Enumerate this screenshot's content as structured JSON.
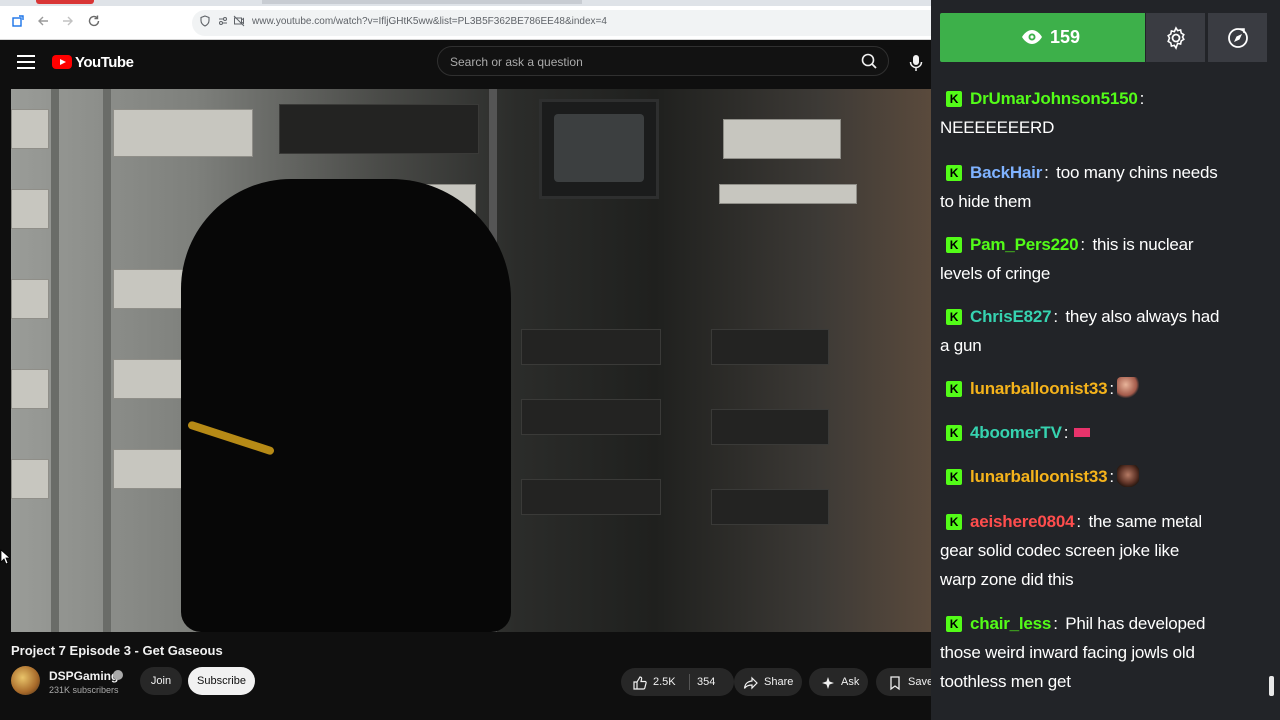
{
  "browser": {
    "url": "www.youtube.com/watch?v=IfljGHtK5ww&list=PL3B5F362BE786EE48&index=4"
  },
  "youtube": {
    "logo_text": "YouTube",
    "search_placeholder": "Search or ask a question"
  },
  "video": {
    "title": "Project 7 Episode 3 - Get Gaseous",
    "channel": "DSPGaming",
    "subscribers": "231K subscribers",
    "join_label": "Join",
    "subscribe_label": "Subscribe",
    "likes": "2.5K",
    "comments": "354",
    "share_label": "Share",
    "ask_label": "Ask",
    "save_label": "Save"
  },
  "chat": {
    "viewer_count": "159",
    "colors": {
      "viewer_bar": "#3db04a",
      "kick_badge": "#53fc18",
      "panel": "#222428"
    },
    "messages": [
      {
        "user": "DrUmarJohnson5150",
        "color": "#53fc18",
        "text_lines": [
          "NEEEEEEERD"
        ]
      },
      {
        "user": "BackHair",
        "color": "#7fb2ff",
        "text_lines": [
          "too many chins needs",
          "to hide them"
        ]
      },
      {
        "user": "Pam_Pers220",
        "color": "#53fc18",
        "text_lines": [
          "this is nuclear",
          "levels of cringe"
        ]
      },
      {
        "user": "ChrisE827",
        "color": "#36d3b0",
        "text_lines": [
          "they also always had",
          "a gun"
        ]
      },
      {
        "user": "lunarballoonist33",
        "color": "#f5b31b",
        "emote": "pointing-emote"
      },
      {
        "user": "4boomerTV",
        "color": "#36d3b0",
        "emote": "100-emote"
      },
      {
        "user": "lunarballoonist33",
        "color": "#f5b31b",
        "emote": "face-emote"
      },
      {
        "user": "aeishere0804",
        "color": "#ff4d4d",
        "text_lines": [
          "the same metal",
          "gear solid codec screen joke like",
          "warp zone did this"
        ]
      },
      {
        "user": "chair_less",
        "color": "#53fc18",
        "text_lines": [
          "Phil has developed",
          "those weird inward facing jowls old",
          "toothless men get"
        ]
      }
    ]
  }
}
